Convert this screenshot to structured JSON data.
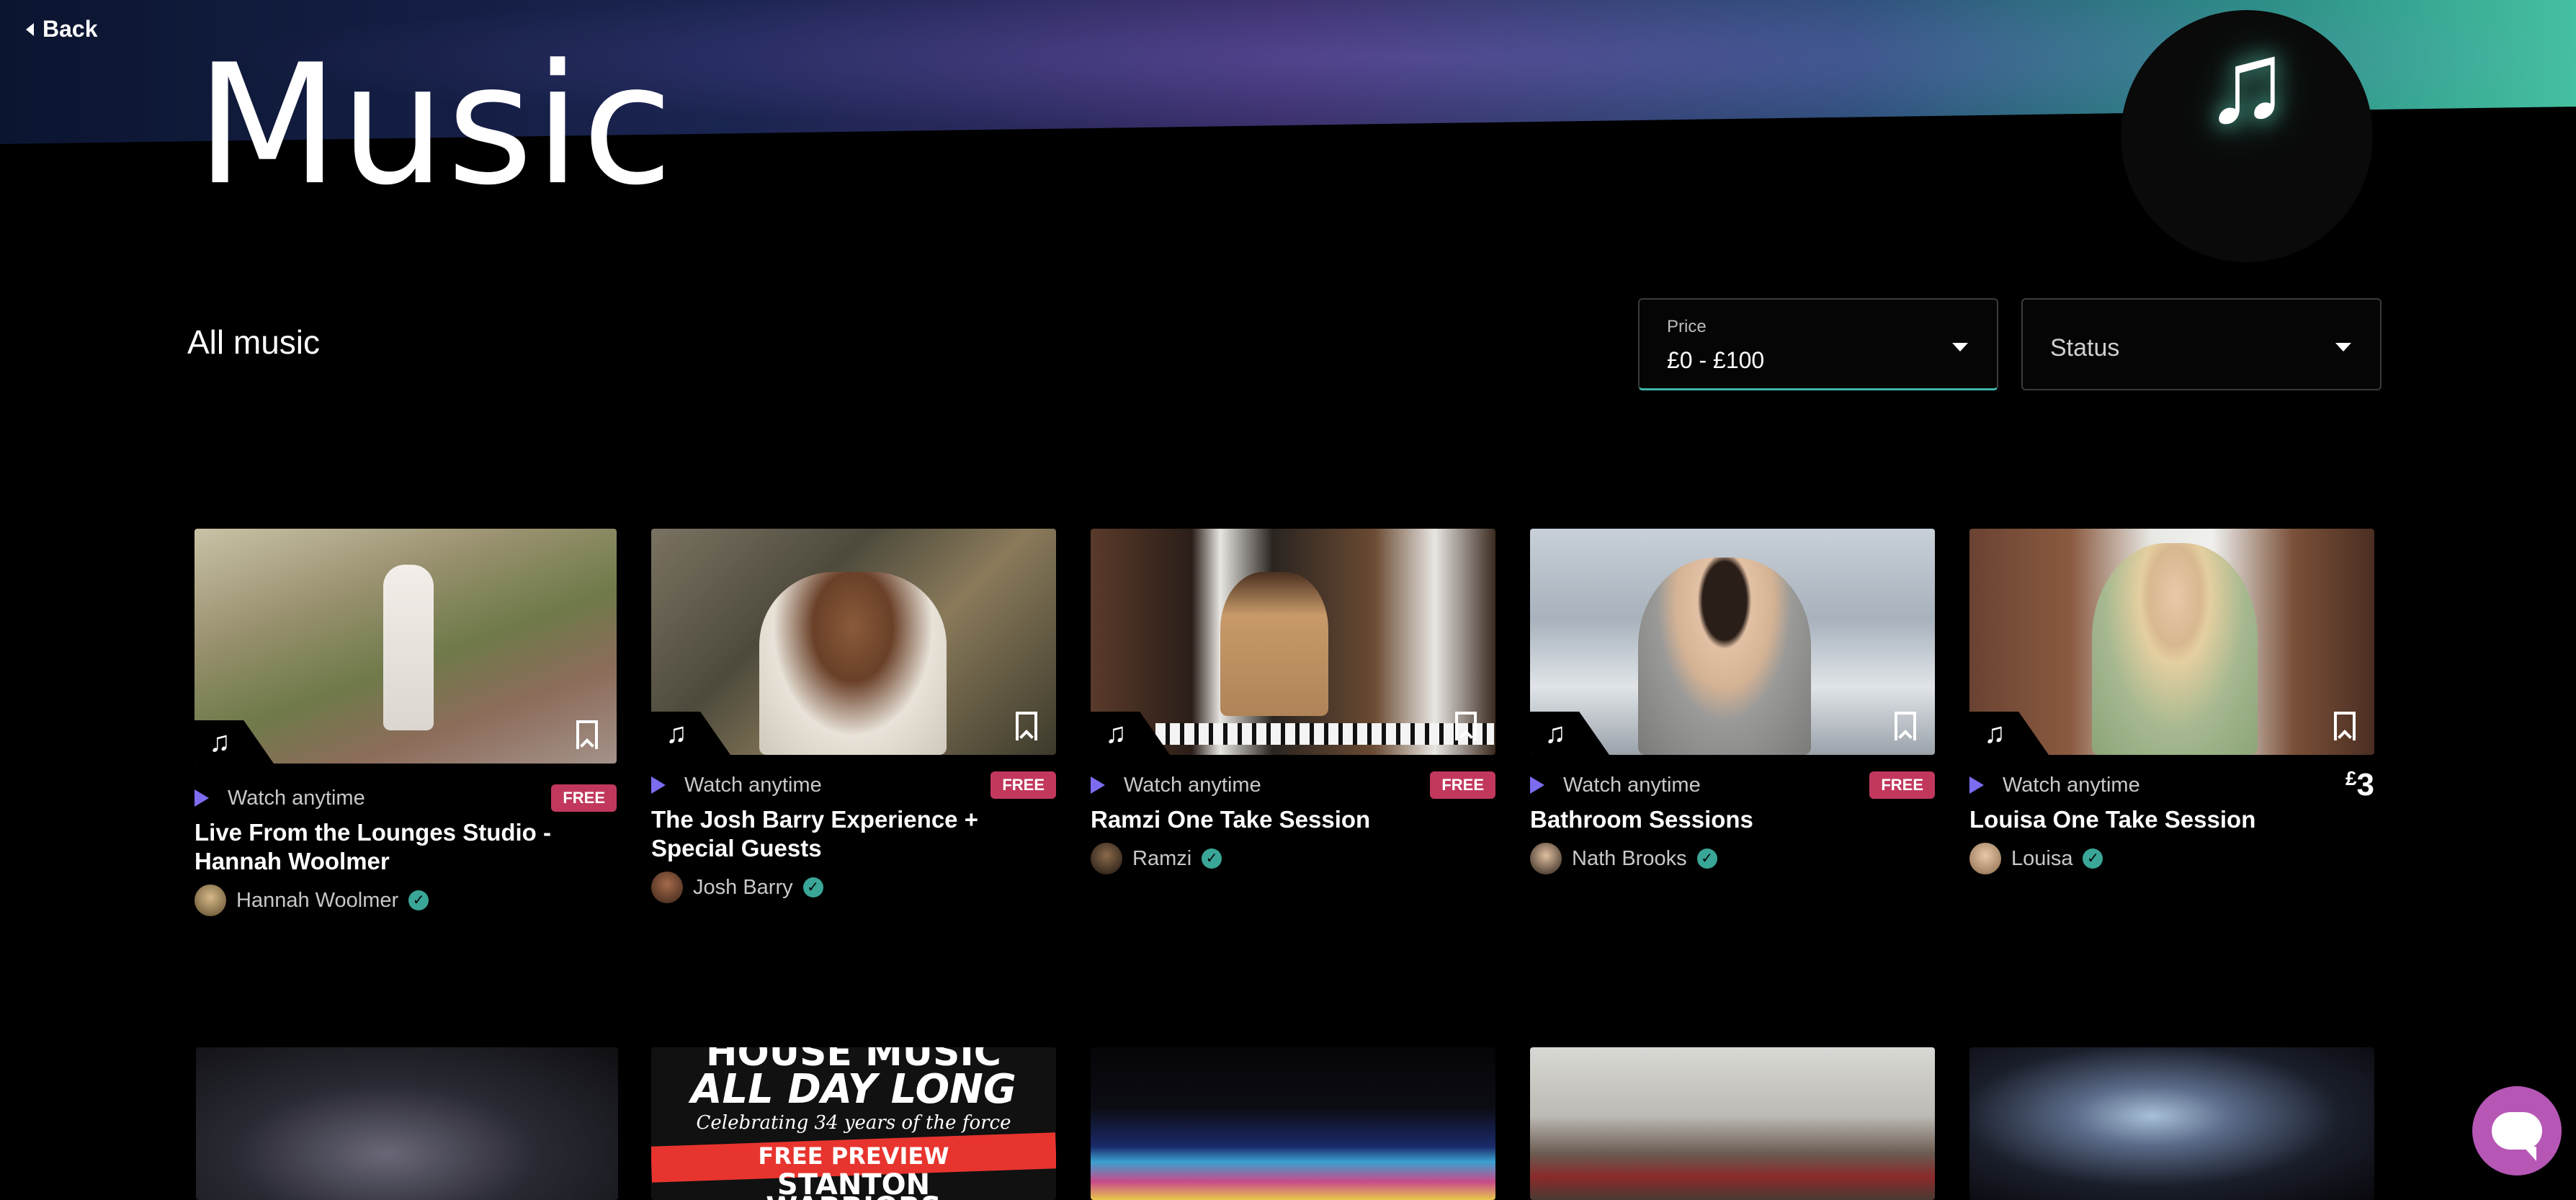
{
  "header": {
    "back_label": "Back",
    "title": "Music",
    "badge_icon": "music-note-icon"
  },
  "toolbar": {
    "section_title": "All music",
    "price_filter": {
      "label": "Price",
      "value": "£0 - £100"
    },
    "status_filter": {
      "placeholder": "Status"
    }
  },
  "cards": [
    {
      "watch_label": "Watch anytime",
      "badge": "FREE",
      "title": "Live From the Lounges Studio - Hannah Woolmer",
      "creator": "Hannah Woolmer"
    },
    {
      "watch_label": "Watch anytime",
      "badge": "FREE",
      "title": "The Josh Barry Experience + Special Guests",
      "creator": "Josh Barry"
    },
    {
      "watch_label": "Watch anytime",
      "badge": "FREE",
      "title": "Ramzi One Take Session",
      "creator": "Ramzi"
    },
    {
      "watch_label": "Watch anytime",
      "badge": "FREE",
      "title": "Bathroom Sessions",
      "creator": "Nath Brooks"
    },
    {
      "watch_label": "Watch anytime",
      "price_currency": "£",
      "price_amount": "3",
      "title": "Louisa One Take Session",
      "creator": "Louisa"
    }
  ],
  "poster": {
    "line1": "HOUSE MUSIC",
    "line2": "ALL DAY LONG",
    "line3": "Celebrating 34 years of the force",
    "preview": "FREE PREVIEW",
    "line4": "STANTON",
    "line5": "WARRIORS"
  },
  "colors": {
    "free_badge": "#c2385d",
    "play_accent": "#7c6cf0",
    "verified": "#3aa697",
    "chat": "#b657b6"
  }
}
